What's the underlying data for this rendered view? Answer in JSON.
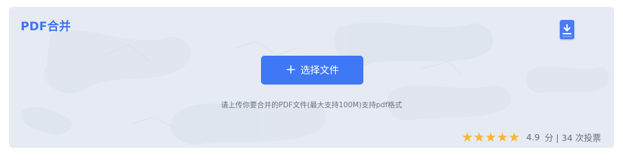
{
  "panel": {
    "title": "PDF合并"
  },
  "upload": {
    "button_label": "选择文件",
    "hint": "请上传你要合并的PDF文件(最大支持100M)支持pdf格式"
  },
  "rating": {
    "score": "4.9",
    "summary": "分 | 34 次投票",
    "stars_filled": 5,
    "stars_total": 5
  },
  "colors": {
    "accent": "#3f78f6",
    "panel_bg": "#e6ebf3",
    "star": "#f7b733"
  },
  "icons": {
    "download": "download-icon",
    "plus": "plus-icon",
    "star": "star-icon"
  }
}
